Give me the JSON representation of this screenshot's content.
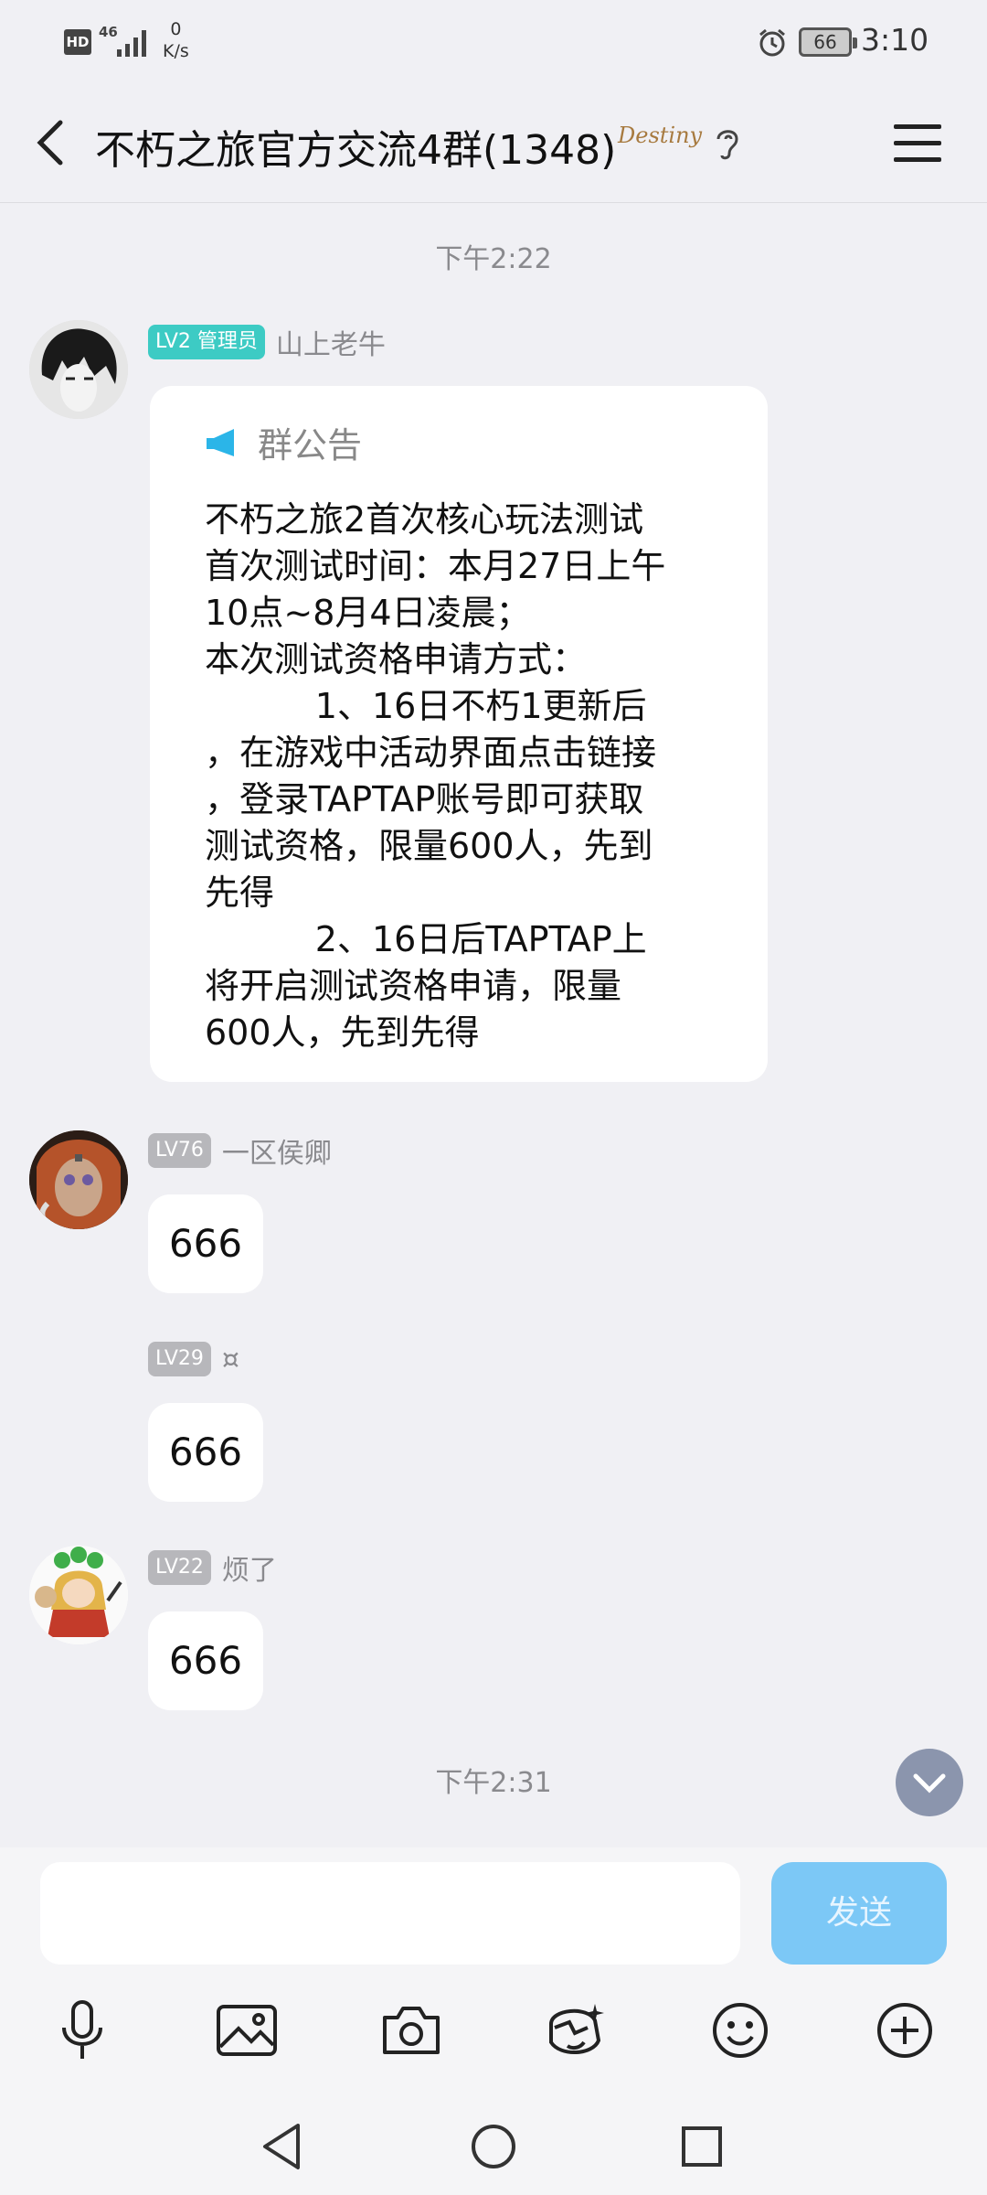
{
  "status": {
    "hd": "HD",
    "network": "4G",
    "speed_value": "0",
    "speed_unit": "K/s",
    "battery": "66",
    "time": "3:10"
  },
  "header": {
    "title": "不朽之旅官方交流4群(1348)",
    "badge_text": "Destiny"
  },
  "timestamps": [
    "下午2:22",
    "下午2:31"
  ],
  "messages": [
    {
      "level": "LV2 管理员",
      "nick": "山上老牛",
      "notice_title": "群公告",
      "notice_lines": [
        "不朽之旅2首次核心玩法测试",
        "首次测试时间：本月27日上午",
        "10点~8月4日凌晨；",
        "本次测试资格申请方式：",
        "          1、16日不朽1更新后",
        "，在游戏中活动界面点击链接",
        "，登录TAPTAP账号即可获取",
        "测试资格，限量600人，先到",
        "先得",
        "          2、16日后TAPTAP上",
        "将开启测试资格申请，限量",
        "600人，先到先得"
      ]
    },
    {
      "level": "LV76",
      "nick": "一区侯卿",
      "text": "666"
    },
    {
      "level": "LV29",
      "nick": "¤",
      "text": "666"
    },
    {
      "level": "LV22",
      "nick": "烦了",
      "text": "666"
    }
  ],
  "input": {
    "placeholder": "",
    "send_label": "发送"
  },
  "colors": {
    "admin_badge": "#3dcbc4",
    "level_badge": "#b7b7bb",
    "send_button": "#7cc8f6",
    "notice_icon": "#2bb5e8"
  }
}
